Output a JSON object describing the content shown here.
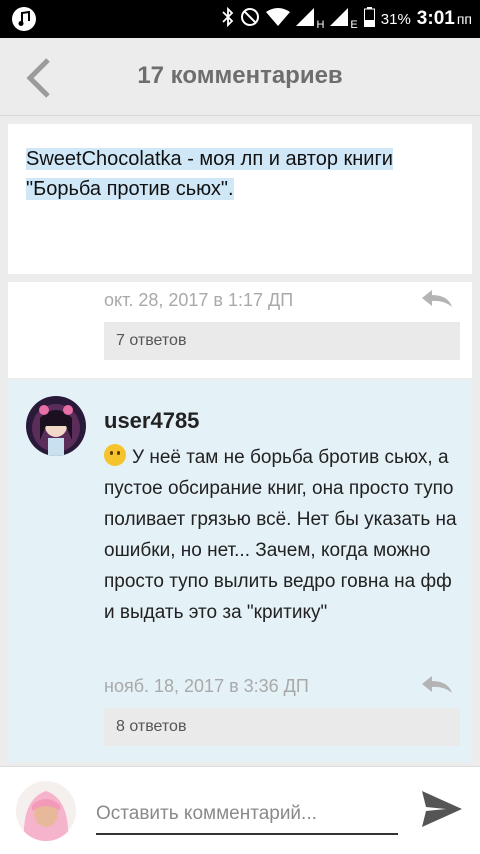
{
  "status_bar": {
    "network_1": "H",
    "network_2": "E",
    "battery_percent": "31%",
    "time": "3:01",
    "time_suffix": "пп"
  },
  "header": {
    "title": "17 комментариев"
  },
  "comments": [
    {
      "text": "SweetChocolatka - моя лп и автор книги \"Борьба против сьюх\".",
      "date": "окт. 28, 2017 в 1:17 ДП",
      "replies": "7 ответов"
    },
    {
      "username": "user4785",
      "text": "У неё там не борьба бротив сьюх, а пустое обсирание книг, она просто тупо поливает грязью всё. Нет бы указать на ошибки, но нет... Зачем, когда можно просто тупо вылить ведро говна на фф и выдать это за \"критику\"",
      "date": "нояб. 18, 2017 в 3:36 ДП",
      "replies": "8 ответов"
    }
  ],
  "composer": {
    "placeholder": "Оставить комментарий..."
  },
  "icons": {
    "status_left": "music-note-icon",
    "bluetooth": "bluetooth-icon",
    "dnd": "do-not-disturb-icon",
    "wifi": "wifi-icon",
    "back": "chevron-left-icon",
    "reply": "reply-arrow-icon",
    "send": "send-icon"
  },
  "colors": {
    "highlight_bg": "#e4f1f7",
    "selection": "#cfe7f7",
    "muted_text": "#a9a9a9"
  }
}
